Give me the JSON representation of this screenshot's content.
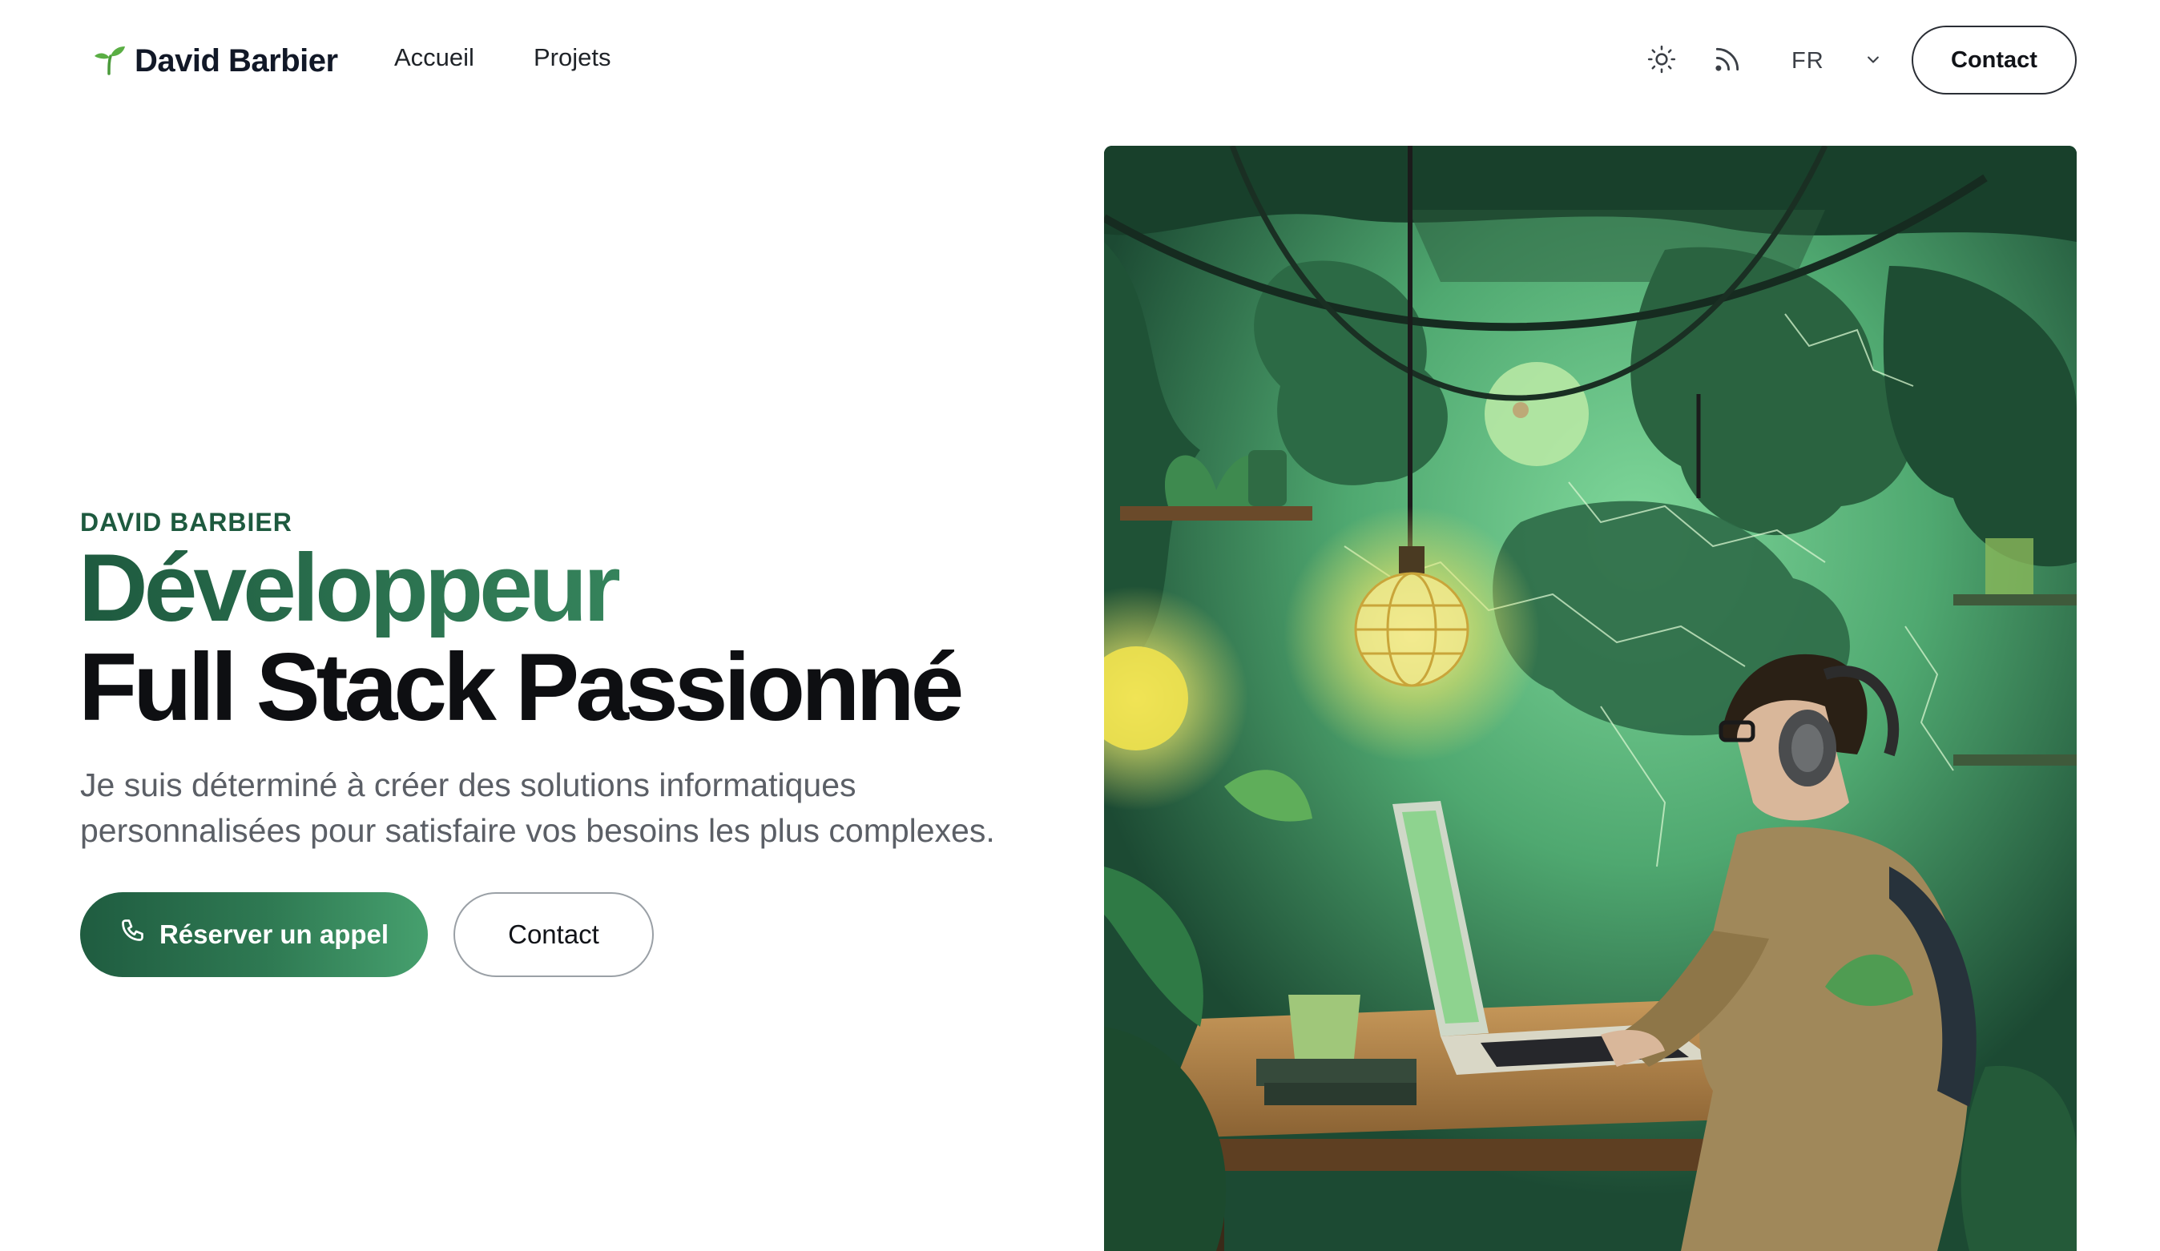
{
  "header": {
    "logo_text": "David Barbier",
    "logo_icon": "sprout-icon",
    "nav": [
      {
        "label": "Accueil"
      },
      {
        "label": "Projets"
      }
    ],
    "theme_toggle_icon": "sun-icon",
    "rss_icon": "rss-icon",
    "language": {
      "selected": "FR",
      "icon": "chevron-down-icon"
    },
    "contact_label": "Contact"
  },
  "hero": {
    "eyebrow": "DAVID BARBIER",
    "title_line1": "Développeur",
    "title_line2": "Full Stack Passionné",
    "subtitle": "Je suis déterminé à créer des solutions informatiques personnalisées pour satisfaire vos besoins les plus complexes.",
    "primary_cta": {
      "label": "Réserver un appel",
      "icon": "phone-icon"
    },
    "secondary_cta": {
      "label": "Contact"
    }
  },
  "colors": {
    "brand_green": "#1e5a3f",
    "brand_green_light": "#46a06e",
    "text_dark": "#0e0f12",
    "text_muted": "#5b5f66"
  }
}
